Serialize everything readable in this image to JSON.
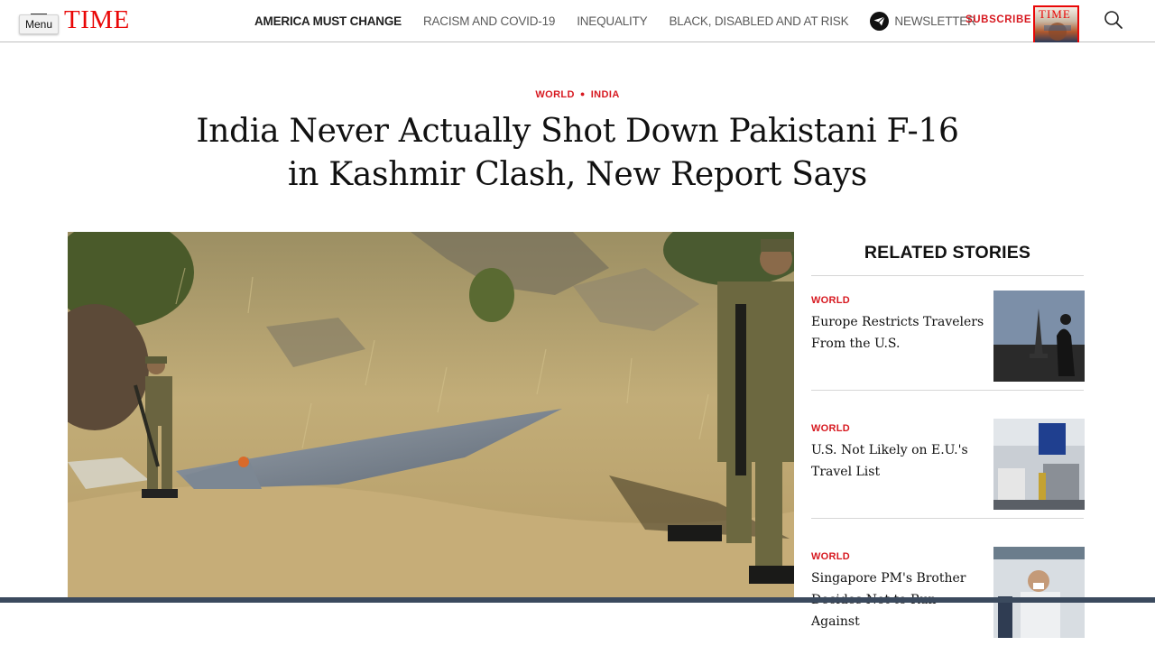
{
  "nav": {
    "menu_label": "Menu",
    "logo_text": "TIME",
    "items": [
      {
        "label": "AMERICA MUST CHANGE",
        "active": true
      },
      {
        "label": "RACISM AND COVID-19",
        "active": false
      },
      {
        "label": "INEQUALITY",
        "active": false
      },
      {
        "label": "BLACK, DISABLED AND AT RISK",
        "active": false
      }
    ],
    "newsletter_label": "NEWSLETTER",
    "subscribe_label": "SUBSCRIBE",
    "cover_title": "TIME"
  },
  "article": {
    "kicker": [
      "WORLD",
      "INDIA"
    ],
    "headline_line1": "India Never Actually Shot Down Pakistani F-16",
    "headline_line2": "in Kashmir Clash, New Report Says"
  },
  "related": {
    "heading": "RELATED STORIES",
    "stories": [
      {
        "tag": "WORLD",
        "title": "Europe Restricts Travelers From the U.S."
      },
      {
        "tag": "WORLD",
        "title": "U.S. Not Likely on E.U.'s Travel List"
      },
      {
        "tag": "WORLD",
        "title": "Singapore PM's Brother Decides Not to Run Against"
      }
    ]
  },
  "colors": {
    "brand_red": "#e90606",
    "kicker_red": "#d71920"
  }
}
